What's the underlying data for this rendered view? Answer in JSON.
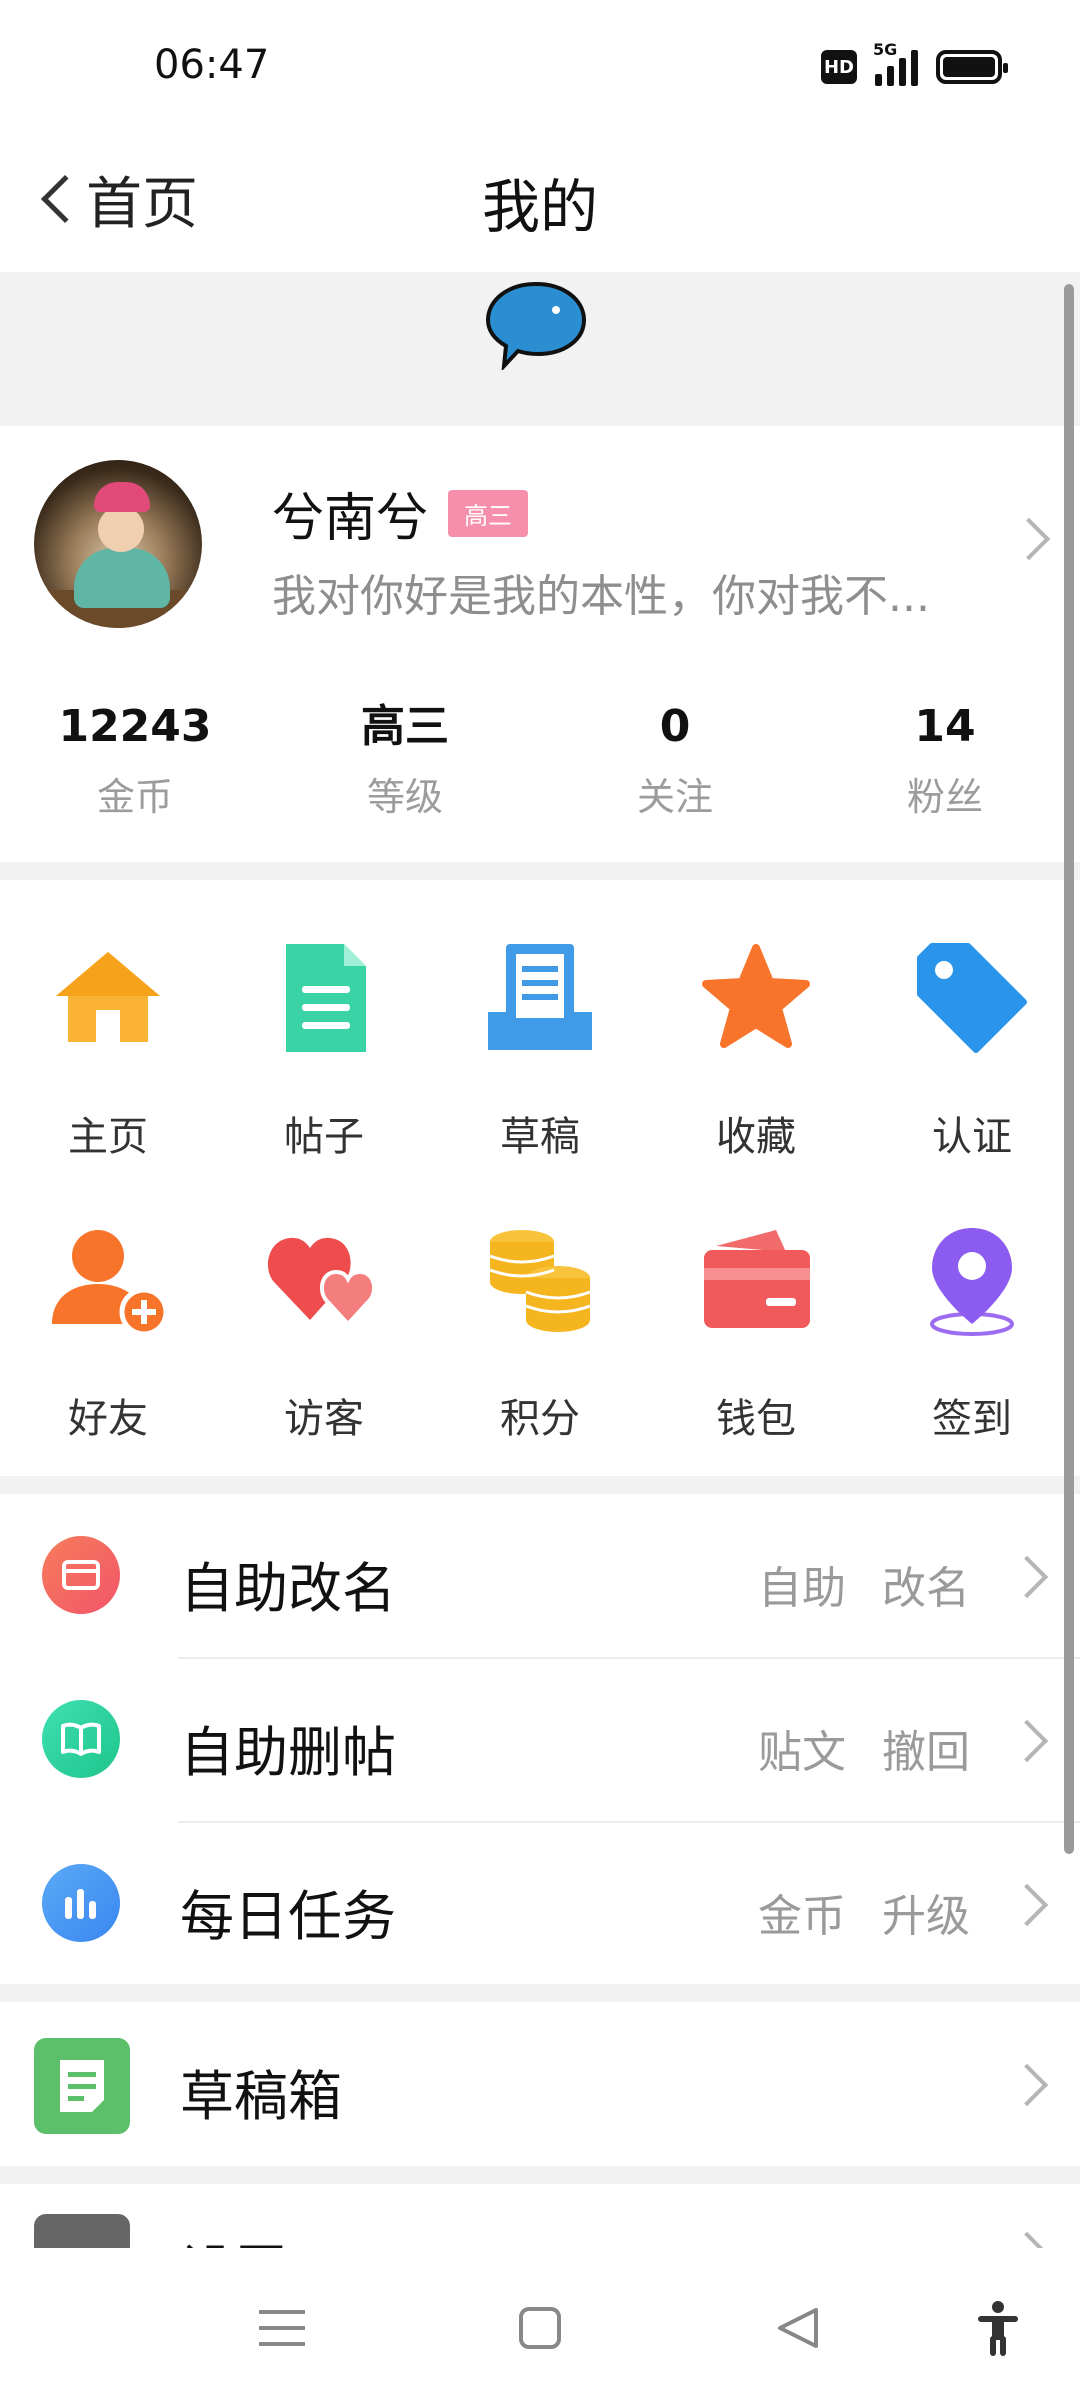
{
  "status_bar": {
    "time": "06:47",
    "hd": "HD",
    "network": "5G"
  },
  "header": {
    "back_label": "首页",
    "title": "我的"
  },
  "profile": {
    "name": "兮南兮",
    "level_badge": "高三",
    "signature": "我对你好是我的本性，你对我不..."
  },
  "stats": [
    {
      "value": "12243",
      "label": "金币"
    },
    {
      "value": "高三",
      "label": "等级"
    },
    {
      "value": "0",
      "label": "关注"
    },
    {
      "value": "14",
      "label": "粉丝"
    }
  ],
  "grid": {
    "row1": [
      {
        "label": "主页",
        "icon": "home-icon"
      },
      {
        "label": "帖子",
        "icon": "post-icon"
      },
      {
        "label": "草稿",
        "icon": "draft-icon"
      },
      {
        "label": "收藏",
        "icon": "star-icon"
      },
      {
        "label": "认证",
        "icon": "tag-icon"
      }
    ],
    "row2": [
      {
        "label": "好友",
        "icon": "add-friend-icon"
      },
      {
        "label": "访客",
        "icon": "visitor-heart-icon"
      },
      {
        "label": "积分",
        "icon": "coins-icon"
      },
      {
        "label": "钱包",
        "icon": "wallet-icon"
      },
      {
        "label": "签到",
        "icon": "location-pin-icon"
      }
    ]
  },
  "list": [
    {
      "title": "自助改名",
      "extra": [
        "自助",
        "改名"
      ],
      "icon": "rename-icon",
      "color": "#f56a5a"
    },
    {
      "title": "自助删帖",
      "extra": [
        "贴文",
        "撤回"
      ],
      "icon": "book-icon",
      "color": "#2fd19a"
    },
    {
      "title": "每日任务",
      "extra": [
        "金币",
        "升级"
      ],
      "icon": "bar-chart-icon",
      "color": "#4a9cf5"
    }
  ],
  "drafts": {
    "title": "草稿箱",
    "icon": "drafts-box-icon",
    "color": "#5cbf6a"
  },
  "settings": {
    "title": "设置",
    "icon": "gear-icon",
    "color": "#666666"
  },
  "navbar": [
    "menu-icon",
    "home-square-icon",
    "back-triangle-icon",
    "accessibility-icon"
  ]
}
